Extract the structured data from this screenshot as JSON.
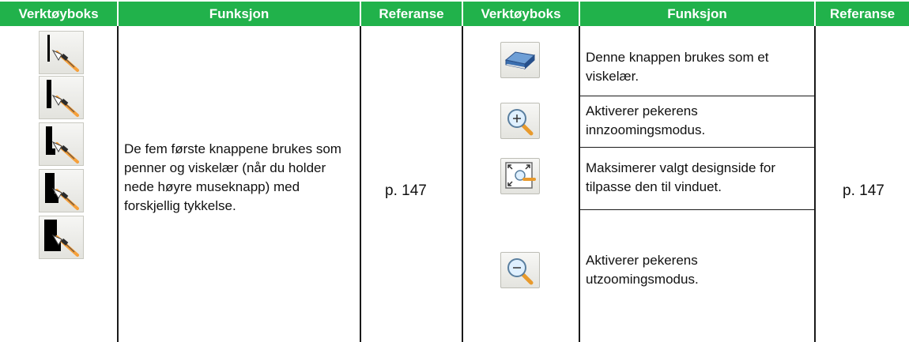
{
  "headers": {
    "toolbox_1": "Verktøyboks",
    "function_1": "Funksjon",
    "reference_1": "Referanse",
    "toolbox_2": "Verktøyboks",
    "function_2": "Funksjon",
    "reference_2": "Referanse"
  },
  "left": {
    "function_text": "De fem første knappene brukes som penner og viskelær (når du holder nede høyre museknapp) med forskjellig tykkelse.",
    "reference": "p. 147",
    "pen_icons": [
      "pen-thin-icon",
      "pen-small-icon",
      "pen-medium-icon",
      "pen-large-icon",
      "pen-thick-icon"
    ]
  },
  "right": {
    "rows": [
      {
        "icon": "eraser-icon",
        "text": "Denne knappen brukes som et viskelær."
      },
      {
        "icon": "zoom-in-icon",
        "text": "Aktiverer pekerens innzoomingsmodus."
      },
      {
        "icon": "fit-to-window-icon",
        "text": "Maksimerer valgt designside for tilpasse den til vinduet."
      },
      {
        "icon": "zoom-out-icon",
        "text": "Aktiverer pekerens utzoomingsmodus."
      }
    ],
    "reference": "p. 147"
  },
  "colors": {
    "header_bg": "#21b24b",
    "header_text": "#ffffff",
    "grid": "#1a1a1a"
  }
}
